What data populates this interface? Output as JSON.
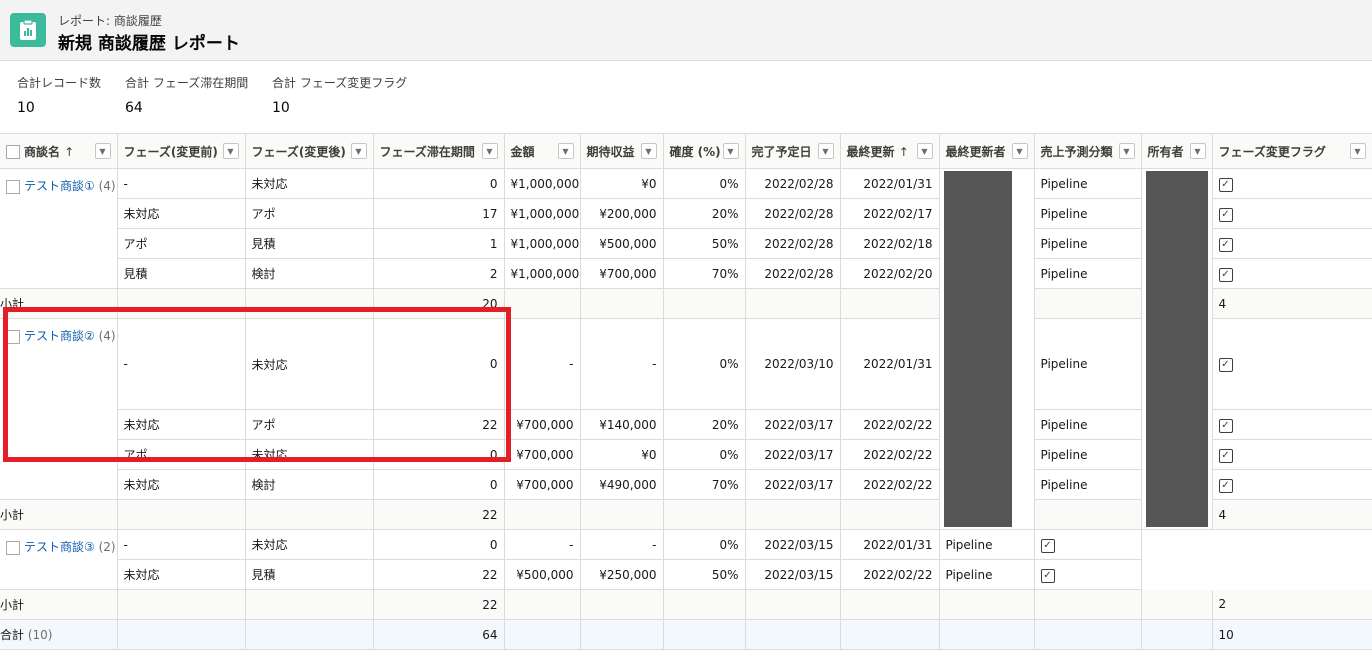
{
  "header": {
    "breadcrumb": "レポート: 商談履歴",
    "title": "新規 商談履歴 レポート",
    "icon": "report-icon"
  },
  "summary": [
    {
      "label": "合計レコード数",
      "value": "10"
    },
    {
      "label": "合計 フェーズ滞在期間",
      "value": "64"
    },
    {
      "label": "合計 フェーズ変更フラグ",
      "value": "10"
    }
  ],
  "columns": [
    "商談名",
    "フェーズ(変更前)",
    "フェーズ(変更後)",
    "フェーズ滞在期間",
    "金額",
    "期待収益",
    "確度 (%)",
    "完了予定日",
    "最終更新",
    "最終更新者",
    "売上予測分類",
    "所有者",
    "フェーズ変更フラグ"
  ],
  "sort_arrow": "↑",
  "groups": [
    {
      "name": "テスト商談①",
      "count": "(4)",
      "rows": [
        [
          "-",
          "未対応",
          "0",
          "¥1,000,000",
          "¥0",
          "0%",
          "2022/02/28",
          "2022/01/31",
          "Pipeline"
        ],
        [
          "未対応",
          "アポ",
          "17",
          "¥1,000,000",
          "¥200,000",
          "20%",
          "2022/02/28",
          "2022/02/17",
          "Pipeline"
        ],
        [
          "アポ",
          "見積",
          "1",
          "¥1,000,000",
          "¥500,000",
          "50%",
          "2022/02/28",
          "2022/02/18",
          "Pipeline"
        ],
        [
          "見積",
          "検討",
          "2",
          "¥1,000,000",
          "¥700,000",
          "70%",
          "2022/02/28",
          "2022/02/20",
          "Pipeline"
        ]
      ],
      "subtotal_label": "小計",
      "subtotal_days": "20",
      "subtotal_flag": "4"
    },
    {
      "name": "テスト商談②",
      "count": "(4)",
      "rows": [
        [
          "-",
          "未対応",
          "0",
          "-",
          "-",
          "0%",
          "2022/03/10",
          "2022/01/31",
          "Pipeline"
        ],
        [
          "未対応",
          "アポ",
          "22",
          "¥700,000",
          "¥140,000",
          "20%",
          "2022/03/17",
          "2022/02/22",
          "Pipeline"
        ],
        [
          "アポ",
          "未対応",
          "0",
          "¥700,000",
          "¥0",
          "0%",
          "2022/03/17",
          "2022/02/22",
          "Pipeline"
        ],
        [
          "未対応",
          "検討",
          "0",
          "¥700,000",
          "¥490,000",
          "70%",
          "2022/03/17",
          "2022/02/22",
          "Pipeline"
        ]
      ],
      "subtotal_label": "小計",
      "subtotal_days": "22",
      "subtotal_flag": "4"
    },
    {
      "name": "テスト商談③",
      "count": "(2)",
      "rows": [
        [
          "-",
          "未対応",
          "0",
          "-",
          "-",
          "0%",
          "2022/03/15",
          "2022/01/31",
          "Pipeline"
        ],
        [
          "未対応",
          "見積",
          "22",
          "¥500,000",
          "¥250,000",
          "50%",
          "2022/03/15",
          "2022/02/22",
          "Pipeline"
        ]
      ],
      "subtotal_label": "小計",
      "subtotal_days": "22",
      "subtotal_flag": "2"
    }
  ],
  "grand_total": {
    "label": "合計",
    "count": "(10)",
    "days": "64",
    "flag": "10"
  },
  "colors": {
    "accent": "#3bba9c",
    "link": "#0b5cab",
    "highlight": "#e41e26",
    "redaction": "#555555"
  }
}
